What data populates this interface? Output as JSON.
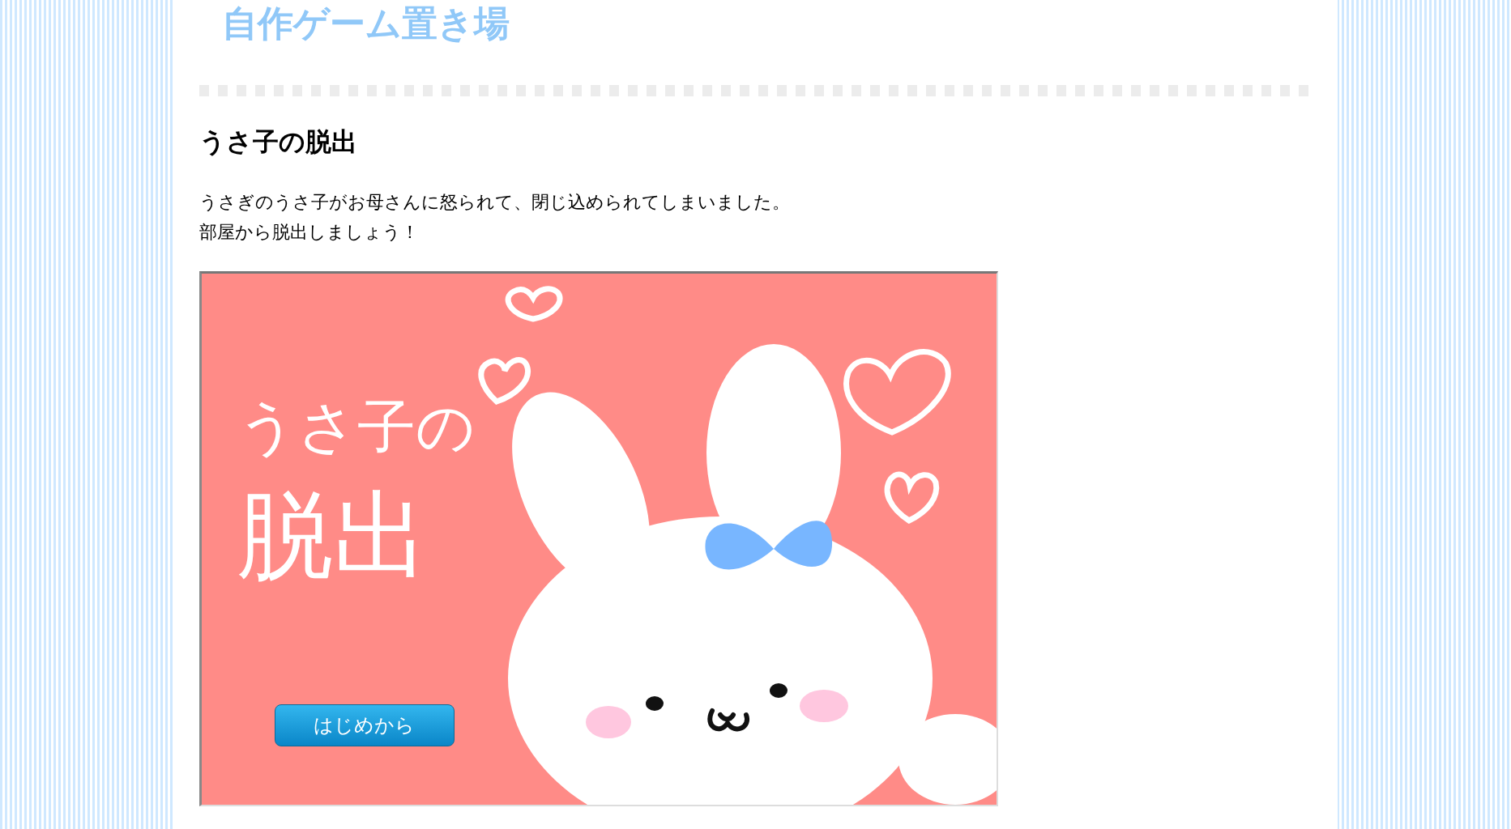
{
  "site_title": "自作ゲーム置き場",
  "article": {
    "heading": "うさ子の脱出",
    "description_lines": [
      "うさぎのうさ子がお母さんに怒られて、閉じ込められてしまいました。",
      "部屋から脱出しましょう！"
    ]
  },
  "game": {
    "title_lines": [
      "うさ子の",
      "脱出"
    ],
    "start_button": "はじめから"
  }
}
